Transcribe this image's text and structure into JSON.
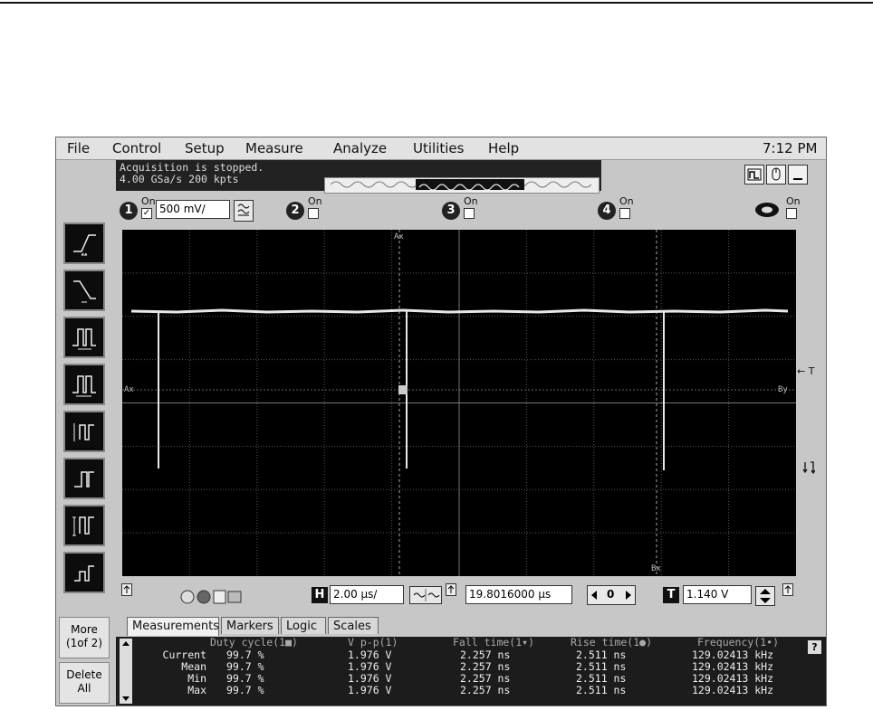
{
  "menu": {
    "file": "File",
    "control": "Control",
    "setup": "Setup",
    "measure": "Measure",
    "analyze": "Analyze",
    "utilities": "Utilities",
    "help": "Help",
    "clock": "7:12 PM"
  },
  "status": {
    "line1": "Acquisition is stopped.",
    "line2": "4.00 GSa/s   200 kpts"
  },
  "channels": {
    "ch1": {
      "num": "1",
      "on_label": "On",
      "checked": "✓",
      "scale": "500 mV/"
    },
    "ch2": {
      "num": "2",
      "on_label": "On"
    },
    "ch3": {
      "num": "3",
      "on_label": "On"
    },
    "ch4": {
      "num": "4",
      "on_label": "On"
    },
    "math": {
      "on_label": "On"
    }
  },
  "screen": {
    "markers": {
      "ax_top": "Ax",
      "ax_left": "Ax",
      "by_right": "By",
      "bx_bottom": "Bx"
    },
    "trigger_label": "← T"
  },
  "side": {
    "more": "More (1of 2)",
    "delete_all": "Delete All"
  },
  "horizontal": {
    "h_label": "H",
    "scale": "2.00 µs/",
    "position": "19.8016000 µs",
    "ref": "0"
  },
  "trigger": {
    "t_label": "T",
    "level": "1.140 V"
  },
  "tabs": [
    "Measurements",
    "Markers",
    "Logic",
    "Scales"
  ],
  "measurements": {
    "headers": [
      "Duty cycle(1■)",
      "V p-p(1)",
      "Fall time(1▾)",
      "Rise time(1●)",
      "Frequency(1•)"
    ],
    "rows": [
      {
        "label": "Current",
        "values": [
          "99.7 %",
          "1.976 V",
          "2.257 ns",
          "2.511 ns",
          "129.02413 kHz"
        ]
      },
      {
        "label": "Mean",
        "values": [
          "99.7 %",
          "1.976 V",
          "2.257 ns",
          "2.511 ns",
          "129.02413 kHz"
        ]
      },
      {
        "label": "Min",
        "values": [
          "99.7 %",
          "1.976 V",
          "2.257 ns",
          "2.511 ns",
          "129.02413 kHz"
        ]
      },
      {
        "label": "Max",
        "values": [
          "99.7 %",
          "1.976 V",
          "2.257 ns",
          "2.511 ns",
          "129.02413 kHz"
        ]
      }
    ],
    "help": "?"
  }
}
